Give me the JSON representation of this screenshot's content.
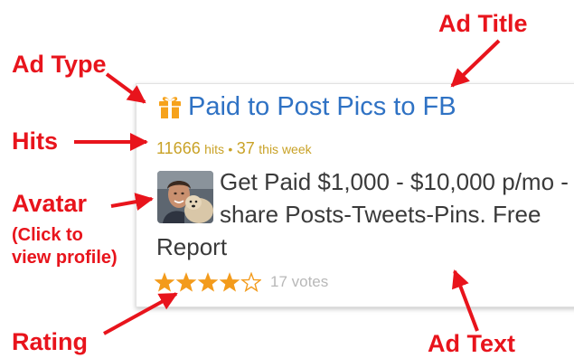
{
  "annotations": {
    "ad_type": "Ad Type",
    "ad_title": "Ad Title",
    "hits": "Hits",
    "avatar": "Avatar",
    "avatar_note": "(Click to\nview profile)",
    "rating": "Rating",
    "ad_text": "Ad Text",
    "color": "#e8141c"
  },
  "ad": {
    "type_icon": "gift-icon",
    "title": "Paid to Post Pics to FB",
    "hits_count": "11666",
    "hits_label": "hits",
    "separator": "•",
    "week_count": "37",
    "week_label": "this week",
    "text": "Get Paid $1,000 - $10,000 p/mo - share Posts-Tweets-Pins. Free Report",
    "rating_value": 4,
    "rating_max": 5,
    "votes": "17 votes",
    "title_color": "#2f72c4",
    "hits_color": "#c9a227",
    "star_color": "#f39b1c"
  }
}
